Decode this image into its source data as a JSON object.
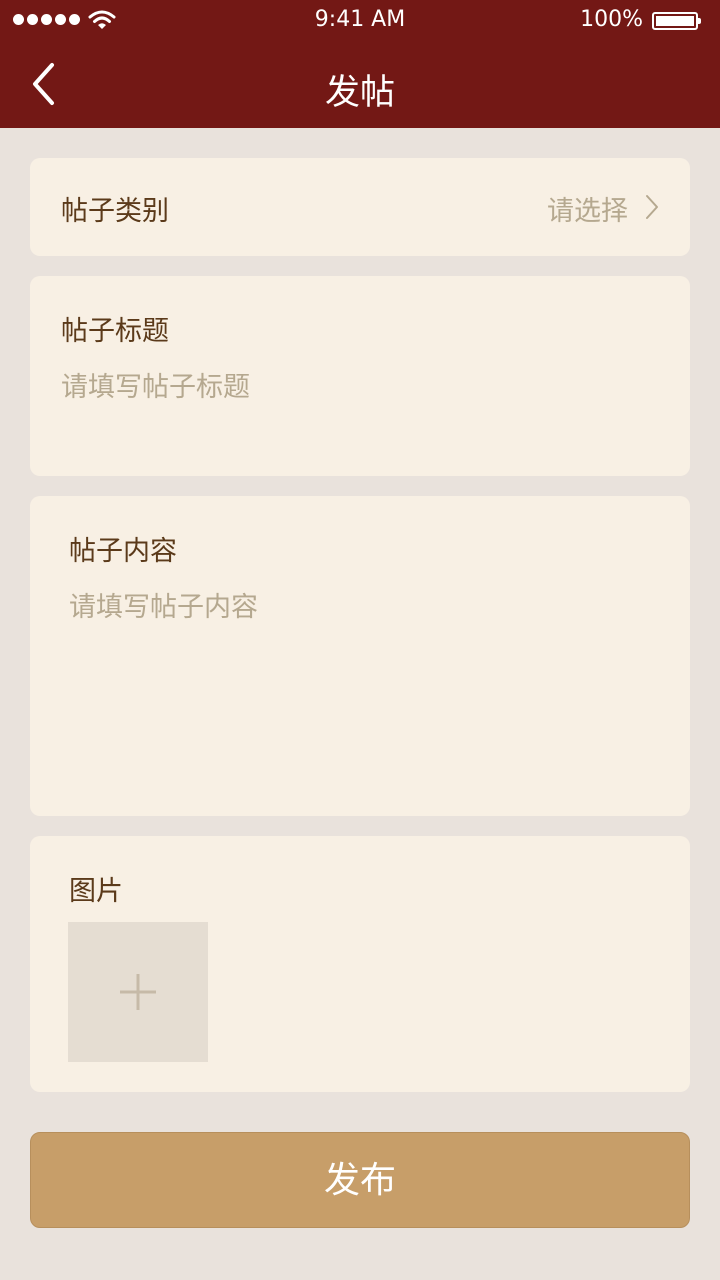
{
  "status_bar": {
    "time": "9:41 AM",
    "battery": "100%"
  },
  "nav": {
    "title": "发帖"
  },
  "category": {
    "label": "帖子类别",
    "value": "请选择"
  },
  "post_title": {
    "label": "帖子标题",
    "placeholder": "请填写帖子标题"
  },
  "post_content": {
    "label": "帖子内容",
    "placeholder": "请填写帖子内容"
  },
  "images": {
    "label": "图片"
  },
  "actions": {
    "publish_label": "发布"
  },
  "colors": {
    "header": "#731815",
    "background": "#e9e2dc",
    "card": "#f8f0e4",
    "accent": "#c79e69"
  }
}
